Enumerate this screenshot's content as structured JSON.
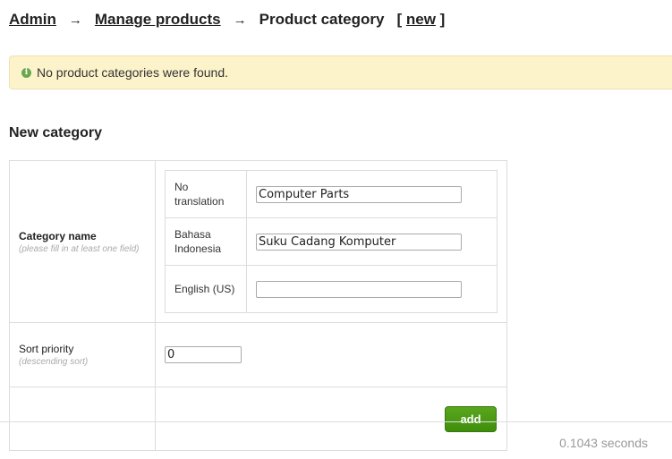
{
  "breadcrumb": {
    "items": [
      {
        "label": "Admin",
        "link": true
      },
      {
        "label": "Manage products",
        "link": true
      },
      {
        "label": "Product category",
        "link": false
      }
    ],
    "separator": "→",
    "action_open": "[",
    "action_label": "new",
    "action_close": "]"
  },
  "notice": {
    "icon": "info-icon",
    "icon_glyph": "i",
    "text": "No product categories were found.",
    "background": "#fcf3cb"
  },
  "form": {
    "heading": "New category",
    "category_name": {
      "label": "Category name",
      "hint": "(please fill in at least one field)",
      "translations": [
        {
          "language_line1": "No",
          "language_line2": "translation",
          "value": "Computer Parts"
        },
        {
          "language_line1": "Bahasa",
          "language_line2": "Indonesia",
          "value": "Suku Cadang Komputer"
        },
        {
          "language_line1": "English (US)",
          "language_line2": "",
          "value": ""
        }
      ]
    },
    "sort_priority": {
      "label": "Sort priority",
      "hint": "(descending sort)",
      "value": "0"
    },
    "submit_label": "add",
    "submit_color": "#4a9a14"
  },
  "footer": {
    "timing": "0.1043 seconds"
  }
}
